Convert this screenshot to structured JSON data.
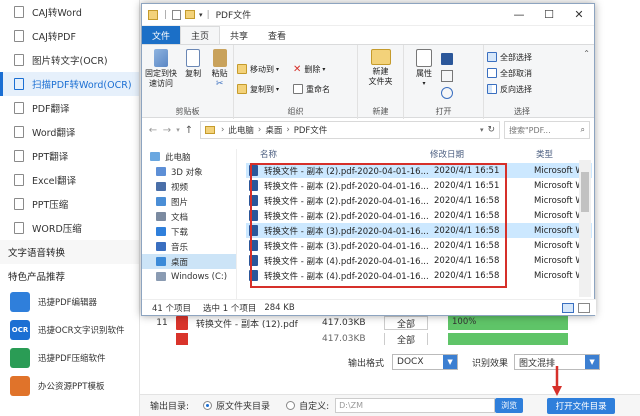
{
  "sidebar": {
    "items": [
      {
        "label": "CAJ转Word"
      },
      {
        "label": "CAJ转PDF"
      },
      {
        "label": "图片转文字(OCR)"
      },
      {
        "label": "扫描PDF转Word(OCR)",
        "active": true
      },
      {
        "label": "PDF翻译"
      },
      {
        "label": "Word翻译"
      },
      {
        "label": "PPT翻译"
      },
      {
        "label": "Excel翻译"
      },
      {
        "label": "PPT压缩"
      },
      {
        "label": "WORD压缩"
      }
    ],
    "section_speech": "文字语音转换",
    "section_featured": "特色产品推荐",
    "featured": [
      {
        "label": "迅捷PDF编辑器",
        "color": "#2f7fdb"
      },
      {
        "label": "迅捷OCR文字识别软件",
        "color": "#1b6fd3",
        "icon_text": "OCR"
      },
      {
        "label": "迅捷PDF压缩软件",
        "color": "#2a9c55"
      },
      {
        "label": "办公资源PPT模板",
        "color": "#e0732a"
      }
    ]
  },
  "background_list": {
    "rows": [
      {
        "num": "11",
        "name": "转换文件 - 副本 (12).pdf",
        "size": "417.03KB",
        "pages": "全部",
        "progress": "100%",
        "progress_value": 1.0
      }
    ],
    "partial_row": {
      "size": "417.03KB",
      "pages": "全部",
      "progress": "100%"
    }
  },
  "output_bar": {
    "format_label": "输出格式",
    "format_value": "DOCX",
    "effect_label": "识别效果",
    "effect_value": "图文混排"
  },
  "dir_bar": {
    "label": "输出目录:",
    "option_original": "原文件夹目录",
    "option_custom": "自定义:",
    "path_placeholder": "D:\\ZM",
    "browse_label": "浏览",
    "open_dir_label": "打开文件目录"
  },
  "explorer": {
    "title": "PDF文件",
    "window_controls": {
      "minimize": "—",
      "maximize": "☐",
      "close": "✕"
    },
    "tabs": [
      "文件",
      "主页",
      "共享",
      "查看"
    ],
    "ribbon": {
      "clipboard": {
        "pin": "固定到快\n速访问",
        "copy": "复制",
        "paste": "粘贴",
        "label": "剪贴板"
      },
      "organize": {
        "move_to": "移动到",
        "copy_to": "复制到",
        "delete": "删除",
        "rename": "重命名",
        "label": "组织"
      },
      "new": {
        "new_folder": "新建\n文件夹",
        "label": "新建"
      },
      "open": {
        "properties": "属性",
        "label": "打开"
      },
      "select": {
        "select_all": "全部选择",
        "select_none": "全部取消",
        "invert": "反向选择",
        "label": "选择"
      }
    },
    "address": {
      "path": [
        "此电脑",
        "桌面",
        "PDF文件"
      ],
      "search_placeholder": "搜索\"PDF..."
    },
    "nav": [
      {
        "label": "此电脑",
        "icon": "computer-icon",
        "color": "#6aa7e0"
      },
      {
        "label": "3D 对象",
        "icon": "cube-icon",
        "color": "#5d8fd6"
      },
      {
        "label": "视频",
        "icon": "video-icon",
        "color": "#4a6fa8"
      },
      {
        "label": "图片",
        "icon": "picture-icon",
        "color": "#4a8ed6"
      },
      {
        "label": "文档",
        "icon": "document-icon",
        "color": "#7b8aa0"
      },
      {
        "label": "下载",
        "icon": "download-icon",
        "color": "#2f7fdb"
      },
      {
        "label": "音乐",
        "icon": "music-icon",
        "color": "#3a6fc0"
      },
      {
        "label": "桌面",
        "icon": "desktop-icon",
        "color": "#3b8ad8",
        "selected": true
      },
      {
        "label": "Windows (C:)",
        "icon": "drive-icon",
        "color": "#8a9bb2"
      }
    ],
    "columns": {
      "name": "名称",
      "modified": "修改日期",
      "type": "类型"
    },
    "files": [
      {
        "name": "转换文件 - 副本 (2).pdf-2020-04-01-16...",
        "date": "2020/4/1 16:51",
        "type": "Microsoft W",
        "highlight": true
      },
      {
        "name": "转换文件 - 副本 (2).pdf-2020-04-01-16...",
        "date": "2020/4/1 16:51",
        "type": "Microsoft W"
      },
      {
        "name": "转换文件 - 副本 (2).pdf-2020-04-01-16...",
        "date": "2020/4/1 16:58",
        "type": "Microsoft W"
      },
      {
        "name": "转换文件 - 副本 (2).pdf-2020-04-01-16...",
        "date": "2020/4/1 16:58",
        "type": "Microsoft W"
      },
      {
        "name": "转换文件 - 副本 (3).pdf-2020-04-01-16...",
        "date": "2020/4/1 16:58",
        "type": "Microsoft W",
        "highlight": true
      },
      {
        "name": "转换文件 - 副本 (3).pdf-2020-04-01-16...",
        "date": "2020/4/1 16:58",
        "type": "Microsoft W"
      },
      {
        "name": "转换文件 - 副本 (4).pdf-2020-04-01-16...",
        "date": "2020/4/1 16:58",
        "type": "Microsoft W"
      },
      {
        "name": "转换文件 - 副本 (4).pdf-2020-04-01-16...",
        "date": "2020/4/1 16:58",
        "type": "Microsoft W"
      }
    ],
    "status": {
      "count": "41 个项目",
      "selected": "选中 1 个项目",
      "size": "284 KB"
    }
  },
  "colors": {
    "accent": "#1b6fd3",
    "highlight_box": "#d6302a",
    "ribbon_file": "#1b6fc7",
    "progress": "#5fc468"
  }
}
